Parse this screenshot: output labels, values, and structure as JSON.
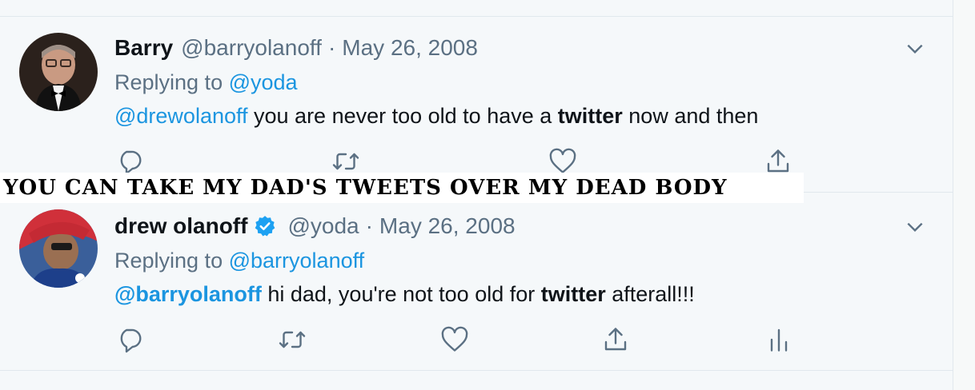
{
  "colors": {
    "link": "#1b95e0",
    "muted": "#5b7083",
    "text": "#0f1419",
    "verified": "#1da1f2"
  },
  "tweets": [
    {
      "name": "Barry",
      "handle": "@barryolanoff",
      "dot": "·",
      "date": "May 26, 2008",
      "replying_prefix": "Replying to",
      "replying_to": "@yoda",
      "mention": "@drewolanoff",
      "text_before": " you are never too old to have a ",
      "bold_word": "twitter",
      "text_after": " now and then",
      "icons": [
        "chevron-down-icon",
        "reply-icon",
        "retweet-icon",
        "like-icon",
        "share-icon"
      ]
    },
    {
      "name": "drew olanoff",
      "verified": true,
      "handle": "@yoda",
      "dot": "·",
      "date": "May 26, 2008",
      "replying_prefix": "Replying to",
      "replying_to": "@barryolanoff",
      "mention": "@barryolanoff",
      "text_before": " hi dad, you're not too old for ",
      "bold_word": "twitter",
      "text_after": " afterall!!!",
      "icons": [
        "chevron-down-icon",
        "reply-icon",
        "retweet-icon",
        "like-icon",
        "share-icon",
        "analytics-icon"
      ]
    }
  ],
  "caption": "YOU CAN TAKE MY DAD'S TWEETS OVER MY DEAD BODY"
}
